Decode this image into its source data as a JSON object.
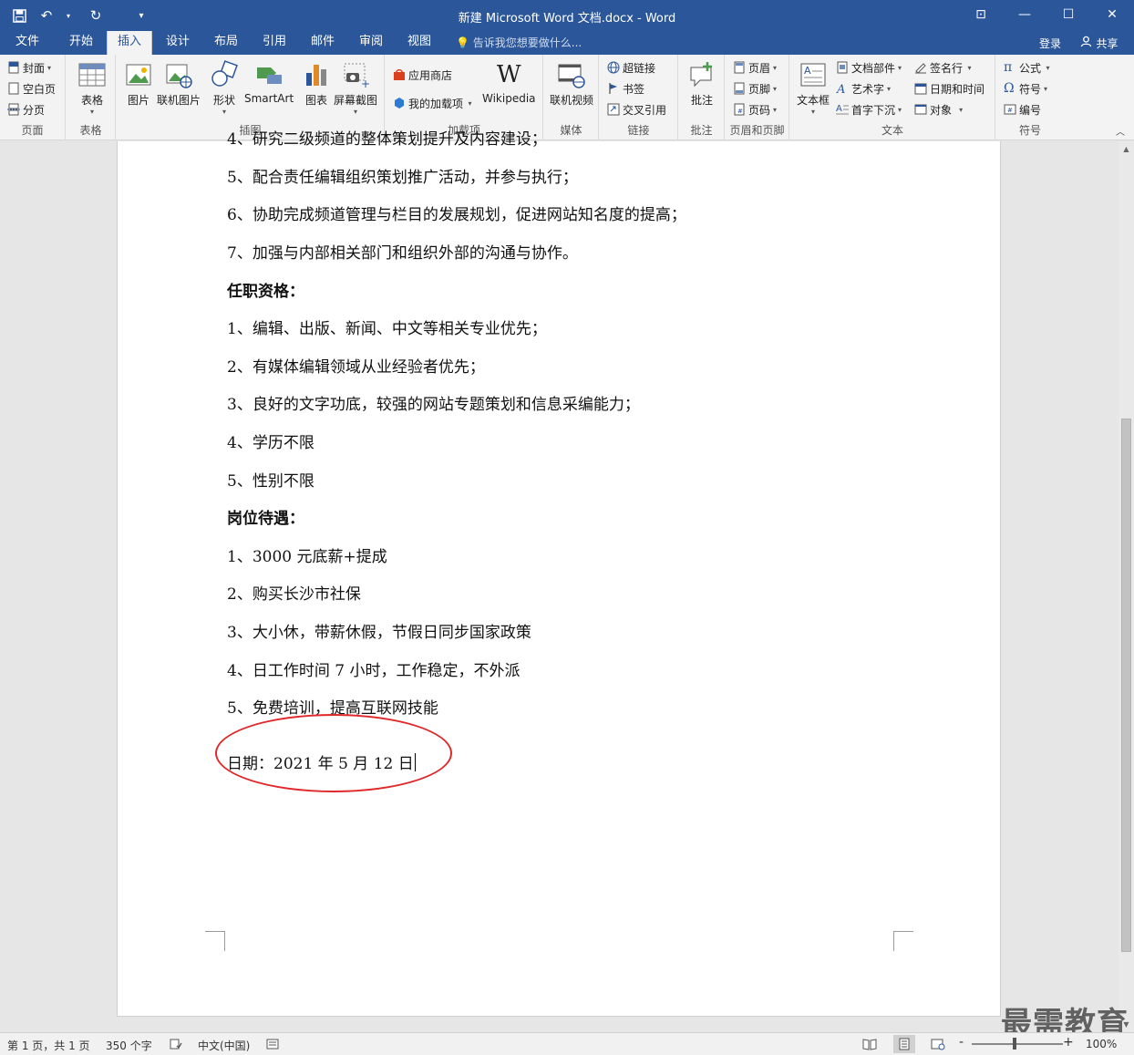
{
  "app": {
    "title": "新建 Microsoft Word 文档.docx - Word"
  },
  "tabs": [
    {
      "label": "文件"
    },
    {
      "label": "开始"
    },
    {
      "label": "插入"
    },
    {
      "label": "设计"
    },
    {
      "label": "布局"
    },
    {
      "label": "引用"
    },
    {
      "label": "邮件"
    },
    {
      "label": "审阅"
    },
    {
      "label": "视图"
    }
  ],
  "tellme": "告诉我您想要做什么...",
  "account": {
    "login": "登录",
    "share": "共享"
  },
  "ribbon": {
    "page": {
      "cover": "封面",
      "blank": "空白页",
      "break": "分页",
      "label": "页面"
    },
    "table": {
      "table": "表格",
      "label": "表格"
    },
    "illustrations": {
      "picture": "图片",
      "online_picture": "联机图片",
      "shapes": "形状",
      "smartart": "SmartArt",
      "chart": "图表",
      "screenshot": "屏幕截图",
      "label": "插图"
    },
    "addins": {
      "store": "应用商店",
      "my_addins": "我的加载项",
      "wikipedia": "Wikipedia",
      "label": "加载项"
    },
    "media": {
      "online_video": "联机视频",
      "label": "媒体"
    },
    "links": {
      "hyperlink": "超链接",
      "bookmark": "书签",
      "cross_ref": "交叉引用",
      "label": "链接"
    },
    "comments": {
      "comment": "批注",
      "label": "批注"
    },
    "header_footer": {
      "header": "页眉",
      "footer": "页脚",
      "page_number": "页码",
      "label": "页眉和页脚"
    },
    "text": {
      "textbox": "文本框",
      "quick_parts": "文档部件",
      "wordart": "艺术字",
      "dropcap": "首字下沉",
      "signature": "签名行",
      "datetime": "日期和时间",
      "object": "对象",
      "label": "文本"
    },
    "symbols": {
      "equation": "公式",
      "symbol": "符号",
      "number": "编号",
      "label": "符号"
    }
  },
  "document": {
    "cut_line": "4、研究二级频道的整体策划提升及内容建设；",
    "lines": [
      "5、配合责任编辑组织策划推广活动，并参与执行；",
      "6、协助完成频道管理与栏目的发展规划，促进网站知名度的提高；",
      "7、加强与内部相关部门和组织外部的沟通与协作。"
    ],
    "heading_qualifications": "任职资格：",
    "qualifications": [
      "1、编辑、出版、新闻、中文等相关专业优先；",
      "2、有媒体编辑领域从业经验者优先；",
      "3、良好的文字功底，较强的网站专题策划和信息采编能力；",
      "4、学历不限",
      "5、性别不限"
    ],
    "heading_benefits": "岗位待遇：",
    "benefits": [
      "1、3000 元底薪+提成",
      "2、购买长沙市社保",
      "3、大小休，带薪休假，节假日同步国家政策",
      "4、日工作时间 7 小时，工作稳定，不外派",
      "5、免费培训，提高互联网技能"
    ],
    "date_line": "日期：2021 年 5 月 12 日"
  },
  "status": {
    "page": "第 1 页，共 1 页",
    "words": "350 个字",
    "language": "中文(中国)",
    "zoom": "100%",
    "zoom_minus": "-",
    "zoom_plus": "+"
  },
  "watermark": "最需教育",
  "colors": {
    "accent": "#2b579a",
    "annotation": "#e0282a"
  }
}
